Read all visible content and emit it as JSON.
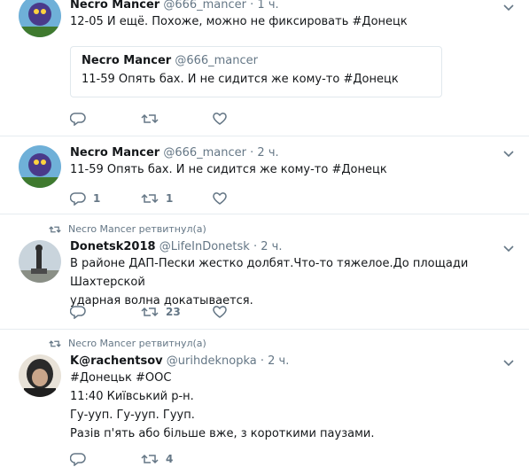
{
  "tweets": [
    {
      "name": "Necro Mancer",
      "handle": "@666_mancer",
      "time": "1 ч.",
      "text": "12-05 И ещё. Похоже, можно не фиксировать ",
      "hashtag": "#Донецк",
      "quote": {
        "name": "Necro Mancer",
        "handle": "@666_mancer",
        "text": "11-59 Опять бах. И не сидится же кому-то ",
        "hashtag": "#Донецк"
      }
    },
    {
      "name": "Necro Mancer",
      "handle": "@666_mancer",
      "time": "2 ч.",
      "text": "11-59 Опять бах. И не сидится же кому-то ",
      "hashtag": "#Донецк",
      "reply_count": "1",
      "retweet_count": "1"
    },
    {
      "retweeted_by": "Necro Mancer ретвитнул(а)",
      "name": "Donetsk2018",
      "handle": "@LifeInDonetsk",
      "time": "2 ч.",
      "text_line1": "В районе ДАП-Пески жестко долбят.Что-то тяжелое.До площади Шахтерской",
      "text_line2": "ударная волна докатывается.",
      "retweet_count": "23"
    },
    {
      "retweeted_by": "Necro Mancer ретвитнул(а)",
      "name": "K@rachentsov",
      "handle": "@urihdeknopka",
      "time": "2 ч.",
      "line1": "#Донецьк #ООС",
      "line2": "11:40 Київський р-н.",
      "line3": "Гу-ууп. Гу-ууп. Гууп.",
      "line4": "Разів п'ять або більше вже, з короткими паузами.",
      "retweet_count": "4"
    }
  ],
  "dot": "·",
  "colors": {
    "secondary": "#657786",
    "border": "#e6ecf0",
    "text": "#14171a"
  }
}
